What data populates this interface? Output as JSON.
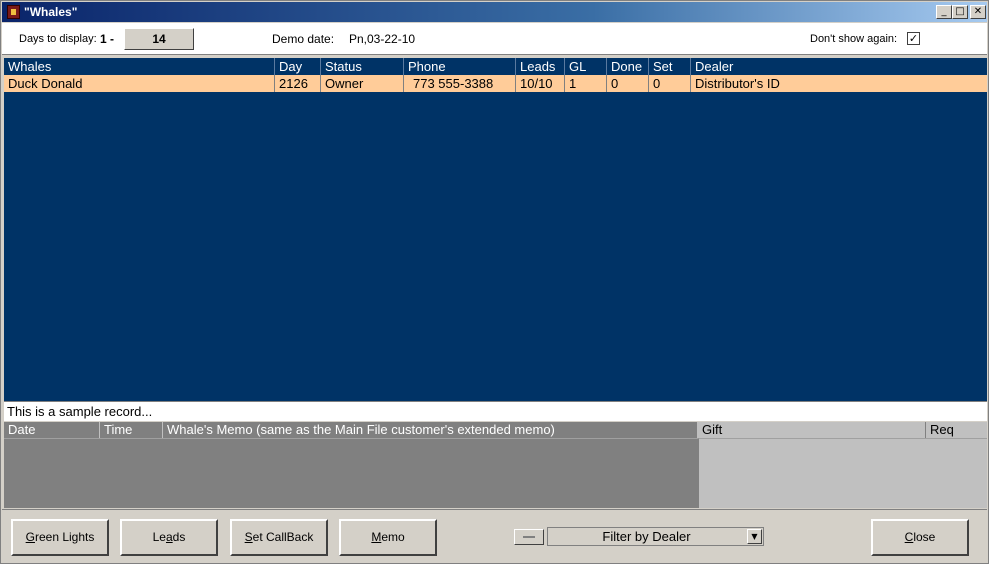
{
  "window": {
    "title": "\"Whales\""
  },
  "titlebar_buttons": {
    "minimize": "_",
    "maximize": "□",
    "close": "✕"
  },
  "toolbar": {
    "days_label": "Days to display:",
    "days_from": "1 -",
    "days_value": "14",
    "demo_date_label": "Demo date:",
    "demo_date_value": "Pn,03-22-10",
    "dont_show_label": "Don't show again:",
    "dont_show_checked": "✓"
  },
  "grid": {
    "headers": [
      "Whales",
      "Day",
      "Status",
      "Phone",
      "Leads",
      "GL",
      "Done",
      "Set",
      "Dealer"
    ],
    "rows": [
      [
        "Duck Donald",
        "2126",
        "Owner",
        "773 555-3388",
        "10/10",
        "1",
        "0",
        "0",
        "Distributor's ID"
      ]
    ]
  },
  "sample_text": "This is a sample record...",
  "memo": {
    "headers": [
      "Date",
      "Time",
      "Whale's Memo (same as the Main File customer's extended memo)"
    ],
    "gift_headers": [
      "Gift",
      "Req"
    ]
  },
  "buttons": {
    "green_lights_u": "G",
    "green_lights_rest": "reen Lights",
    "leads_pre": "Le",
    "leads_u": "a",
    "leads_post": "ds",
    "callback_u": "S",
    "callback_rest": "et CallBack",
    "memo_u": "M",
    "memo_rest": "emo",
    "close_u": "C",
    "close_rest": "lose"
  },
  "filter": {
    "value": "Filter by Dealer",
    "arrow": "▼"
  },
  "colors": {
    "grid_bg": "#003366",
    "selected_row": "#ffcc99",
    "memo_bg": "#808080"
  }
}
